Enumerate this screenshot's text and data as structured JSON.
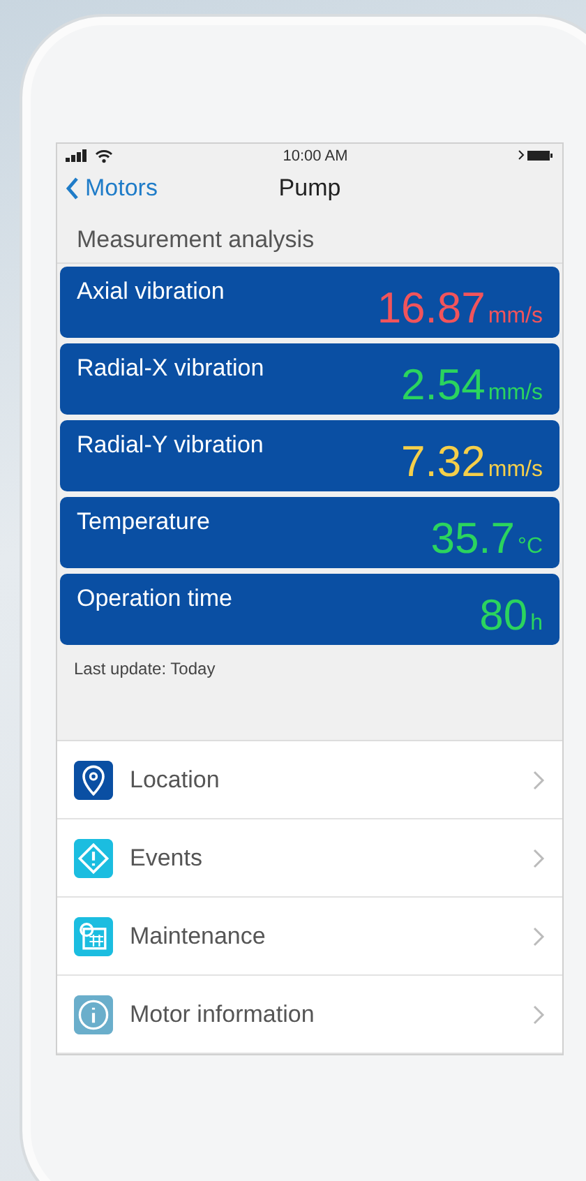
{
  "status_bar": {
    "time": "10:00 AM"
  },
  "nav": {
    "back": "Motors",
    "title": "Pump"
  },
  "section_title": "Measurement analysis",
  "measurements": [
    {
      "name": "Axial vibration",
      "value": "16.87",
      "unit": "mm/s",
      "color": "#f2545b"
    },
    {
      "name": "Radial-X vibration",
      "value": "2.54",
      "unit": "mm/s",
      "color": "#2bd45e"
    },
    {
      "name": "Radial-Y vibration",
      "value": "7.32",
      "unit": "mm/s",
      "color": "#f5cf4a"
    },
    {
      "name": "Temperature",
      "value": "35.7",
      "unit": "°C",
      "color": "#2bd45e"
    },
    {
      "name": "Operation time",
      "value": "80",
      "unit": "h",
      "color": "#2bd45e"
    }
  ],
  "last_update": "Last update: Today",
  "menu": [
    {
      "label": "Location",
      "kind": "location",
      "color": "#0a4fa3"
    },
    {
      "label": "Events",
      "kind": "events",
      "color": "#1bbde0"
    },
    {
      "label": "Maintenance",
      "kind": "maintenance",
      "color": "#1bbde0"
    },
    {
      "label": "Motor information",
      "kind": "info",
      "color": "#6aaecb"
    }
  ]
}
